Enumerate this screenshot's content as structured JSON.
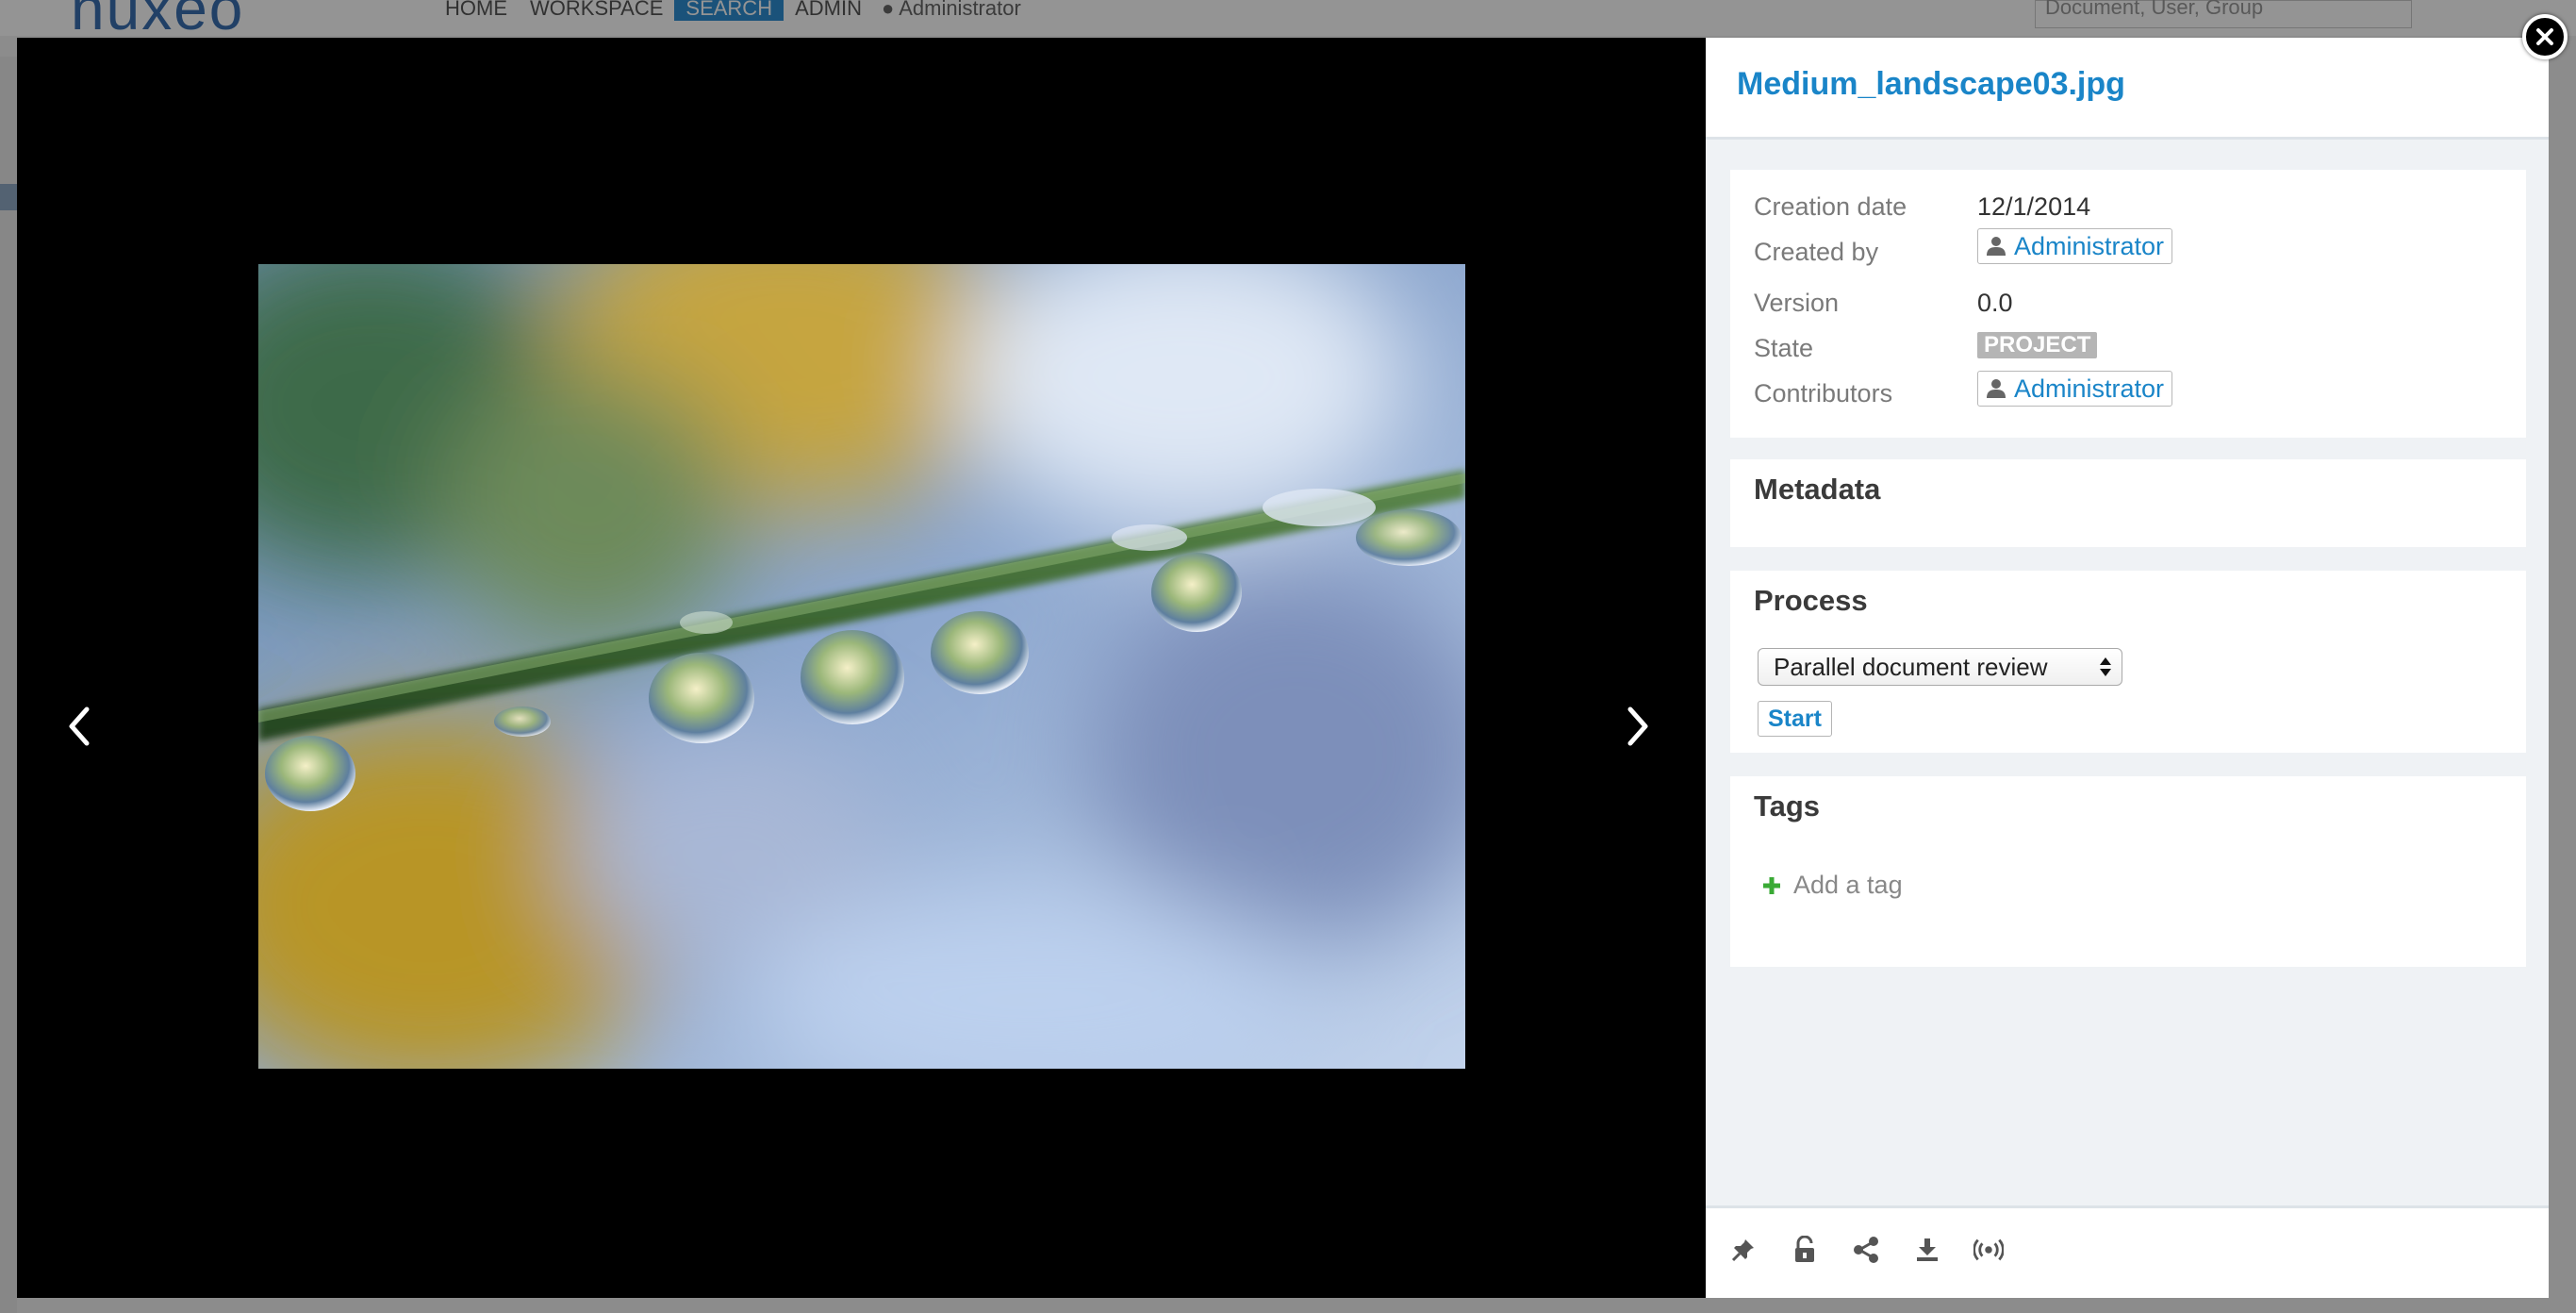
{
  "background": {
    "logo": "nuxeo",
    "nav": [
      "HOME",
      "WORKSPACE",
      "SEARCH",
      "ADMIN"
    ],
    "active_nav": "SEARCH",
    "user": "Administrator",
    "search_placeholder": "Document, User, Group"
  },
  "viewer": {
    "prev_icon": "chevron-left-icon",
    "next_icon": "chevron-right-icon"
  },
  "document": {
    "title": "Medium_landscape03.jpg"
  },
  "summary": {
    "creation_date_label": "Creation date",
    "creation_date": "12/1/2014",
    "created_by_label": "Created by",
    "created_by": "Administrator",
    "version_label": "Version",
    "version": "0.0",
    "state_label": "State",
    "state": "PROJECT",
    "contributors_label": "Contributors",
    "contributor": "Administrator"
  },
  "metadata": {
    "title": "Metadata"
  },
  "process": {
    "title": "Process",
    "selected_workflow": "Parallel document review",
    "start_label": "Start"
  },
  "tags": {
    "title": "Tags",
    "add_label": "Add a tag"
  },
  "footer": {
    "icons": [
      "pin-icon",
      "unlock-icon",
      "share-icon",
      "download-icon",
      "broadcast-icon"
    ]
  },
  "colors": {
    "accent": "#1a85c8",
    "panel_bg": "#eff2f5",
    "state_badge": "#b5b5b5",
    "add_tag_plus": "#3aaa35"
  }
}
